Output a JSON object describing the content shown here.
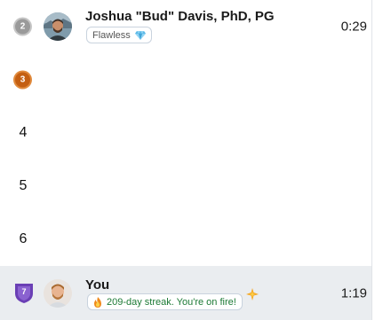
{
  "rows": [
    {
      "rank": "2",
      "name": "Joshua \"Bud\" Davis, PhD, PG",
      "badge": "Flawless",
      "time": "0:29",
      "medal": "silver",
      "badge_icon": "diamond-icon"
    },
    {
      "rank": "3",
      "medal": "bronze"
    },
    {
      "rank": "4"
    },
    {
      "rank": "5"
    },
    {
      "rank": "6"
    }
  ],
  "me": {
    "level": "7",
    "name": "You",
    "streak": "209-day streak. You're on fire!",
    "time": "1:19",
    "streak_icon": "flame-icon"
  },
  "colors": {
    "highlight_row": "#eaedf0",
    "streak_text": "#1c7a35",
    "shield": "#6a3fb5",
    "bronze": "#c45f12",
    "silver": "#9a9a9a"
  }
}
